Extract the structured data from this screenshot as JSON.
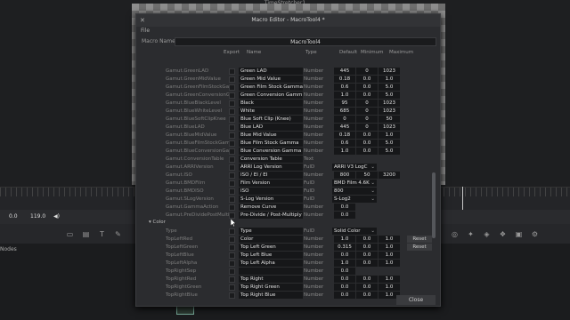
{
  "app": {
    "title": "TimeStretcher1",
    "timecode_start": "0.0",
    "timecode_end": "119.0",
    "nodes_label": "Nodes"
  },
  "dialog": {
    "title": "Macro Editor - MacroTool4 *",
    "menu_file": "File",
    "macro_name_label": "Macro Name",
    "macro_name_value": "MacroTool4",
    "columns": {
      "export": "Export",
      "name": "Name",
      "type": "Type",
      "default": "Default",
      "minimum": "Minimum",
      "maximum": "Maximum"
    },
    "close_button": "Close",
    "rows": [
      {
        "id": "Gamut.GreenLAD",
        "name": "Green LAD",
        "type": "Number",
        "def": "445",
        "min": "0",
        "max": "1023"
      },
      {
        "id": "Gamut.GreenMidValue",
        "name": "Green Mid Value",
        "type": "Number",
        "def": "0.18",
        "min": "0.0",
        "max": "1.0"
      },
      {
        "id": "Gamut.GreenFilmStockGam",
        "name": "Green Film Stock Gamma",
        "type": "Number",
        "def": "0.6",
        "min": "0.0",
        "max": "5.0"
      },
      {
        "id": "Gamut.GreenConversionGa",
        "name": "Green Conversion Gamm",
        "type": "Number",
        "def": "1.0",
        "min": "0.0",
        "max": "5.0"
      },
      {
        "id": "Gamut.BlueBlackLevel",
        "name": "Black",
        "type": "Number",
        "def": "95",
        "min": "0",
        "max": "1023"
      },
      {
        "id": "Gamut.BlueWhiteLevel",
        "name": "White",
        "type": "Number",
        "def": "685",
        "min": "0",
        "max": "1023"
      },
      {
        "id": "Gamut.BlueSoftClipKnee",
        "name": "Blue Soft Clip (Knee)",
        "type": "Number",
        "def": "0",
        "min": "0",
        "max": "50"
      },
      {
        "id": "Gamut.BlueLAD",
        "name": "Blue LAD",
        "type": "Number",
        "def": "445",
        "min": "0",
        "max": "1023"
      },
      {
        "id": "Gamut.BlueMidValue",
        "name": "Blue Mid Value",
        "type": "Number",
        "def": "0.18",
        "min": "0.0",
        "max": "1.0"
      },
      {
        "id": "Gamut.BlueFilmStockGamm",
        "name": "Blue Film Stock Gamma",
        "type": "Number",
        "def": "0.6",
        "min": "0.0",
        "max": "5.0"
      },
      {
        "id": "Gamut.BlueConversionGam",
        "name": "Blue Conversion Gamma",
        "type": "Number",
        "def": "1.0",
        "min": "0.0",
        "max": "5.0"
      },
      {
        "id": "Gamut.ConversionTable",
        "name": "Conversion Table",
        "type": "Text",
        "def": "",
        "min": "",
        "max": ""
      },
      {
        "id": "Gamut.ARRIVersion",
        "name": "ARRI Log Version",
        "type": "FuID",
        "wide": "ARRI V3 LogC"
      },
      {
        "id": "Gamut.ISO",
        "name": "ISO / EI / EI",
        "type": "Number",
        "def": "800",
        "min": "50",
        "max": "3200"
      },
      {
        "id": "Gamut.BMDFilm",
        "name": "Film Version",
        "type": "FuID",
        "wide": "BMD Film 4.6K"
      },
      {
        "id": "Gamut.BMDISO",
        "name": "ISO",
        "type": "FuID",
        "wide": "800"
      },
      {
        "id": "Gamut.SLogVersion",
        "name": "S-Log Version",
        "type": "FuID",
        "wide": "S-Log2"
      },
      {
        "id": "Gamut.GammaAction",
        "name": "Remove Curve",
        "type": "Number",
        "def": "0.0",
        "min": "",
        "max": ""
      },
      {
        "id": "Gamut.PreDividePostMultip",
        "name": "Pre-Divide / Post-Multiply",
        "type": "Number",
        "def": "0.0",
        "min": "",
        "max": ""
      }
    ],
    "group_label": "Color",
    "group_rows": [
      {
        "id": "Type",
        "name": "Type",
        "type": "FuID",
        "wide": "Solid Color"
      },
      {
        "id": "TopLeftRed",
        "name": "Color",
        "type": "Number",
        "def": "1.0",
        "min": "0.0",
        "max": "1.0",
        "reset": "Reset"
      },
      {
        "id": "TopLeftGreen",
        "name": "Top Left Green",
        "type": "Number",
        "def": "0.315",
        "min": "0.0",
        "max": "1.0",
        "reset": "Reset"
      },
      {
        "id": "TopLeftBlue",
        "name": "Top Left Blue",
        "type": "Number",
        "def": "0.0",
        "min": "0.0",
        "max": "1.0"
      },
      {
        "id": "TopLeftAlpha",
        "name": "Top Left Alpha",
        "type": "Number",
        "def": "1.0",
        "min": "0.0",
        "max": "1.0"
      },
      {
        "id": "TopRightSep",
        "name": "",
        "type": "Number",
        "def": "0.0",
        "min": "",
        "max": ""
      },
      {
        "id": "TopRightRed",
        "name": "Top Right",
        "type": "Number",
        "def": "0.0",
        "min": "0.0",
        "max": "1.0"
      },
      {
        "id": "TopRightGreen",
        "name": "Top Right Green",
        "type": "Number",
        "def": "0.0",
        "min": "0.0",
        "max": "1.0"
      },
      {
        "id": "TopRightBlue",
        "name": "Top Right Blue",
        "type": "Number",
        "def": "0.0",
        "min": "0.0",
        "max": "1.0"
      }
    ]
  }
}
